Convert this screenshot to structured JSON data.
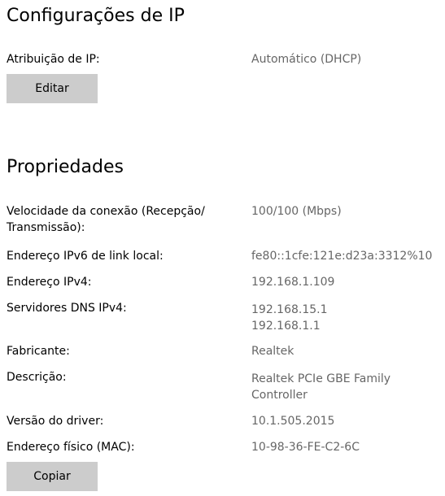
{
  "ip_settings": {
    "title": "Configurações de IP",
    "assignment_label": "Atribuição de IP:",
    "assignment_value": "Automático (DHCP)",
    "edit_button": "Editar"
  },
  "properties": {
    "title": "Propriedades",
    "rows": [
      {
        "label": "Velocidade da conexão (Recepção/\nTransmissão):",
        "value": "100/100 (Mbps)"
      },
      {
        "label": "Endereço IPv6 de link local:",
        "value": "fe80::1cfe:121e:d23a:3312%10"
      },
      {
        "label": "Endereço IPv4:",
        "value": "192.168.1.109"
      },
      {
        "label": "Servidores DNS IPv4:",
        "value": "192.168.15.1\n192.168.1.1"
      },
      {
        "label": "Fabricante:",
        "value": "Realtek"
      },
      {
        "label": "Descrição:",
        "value": "Realtek PCIe GBE Family\nController"
      },
      {
        "label": "Versão do driver:",
        "value": "10.1.505.2015"
      },
      {
        "label": "Endereço físico (MAC):",
        "value": "10-98-36-FE-C2-6C"
      }
    ],
    "copy_button": "Copiar"
  },
  "colors": {
    "button_bg": "#cccccc",
    "value_text": "#666666"
  }
}
